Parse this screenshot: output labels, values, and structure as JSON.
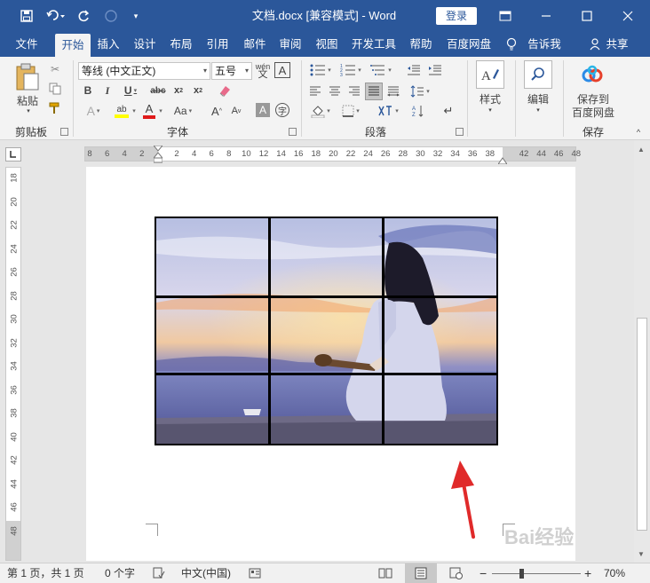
{
  "titlebar": {
    "doc_title": "文档.docx [兼容模式] - Word",
    "login": "登录"
  },
  "tabs": [
    "文件",
    "开始",
    "插入",
    "设计",
    "布局",
    "引用",
    "邮件",
    "审阅",
    "视图",
    "开发工具",
    "帮助",
    "百度网盘"
  ],
  "tell_me": "告诉我",
  "share": "共享",
  "ribbon": {
    "clipboard": {
      "paste": "粘贴",
      "label": "剪贴板"
    },
    "font": {
      "name": "等线 (中文正文)",
      "size": "五号",
      "label": "字体"
    },
    "paragraph": {
      "label": "段落"
    },
    "styles": {
      "button": "样式",
      "label": "样式"
    },
    "editing": {
      "button": "编辑"
    },
    "save": {
      "button_line1": "保存到",
      "button_line2": "百度网盘",
      "label": "保存"
    }
  },
  "ruler": {
    "h_left": [
      "8",
      "6",
      "4",
      "2"
    ],
    "h_main": [
      "2",
      "4",
      "6",
      "8",
      "10",
      "12",
      "14",
      "16",
      "18",
      "20",
      "22",
      "24",
      "26",
      "28",
      "30",
      "32",
      "34",
      "36",
      "38"
    ],
    "h_right": [
      "42",
      "44",
      "46",
      "48"
    ],
    "v": [
      "18",
      "20",
      "22",
      "24",
      "26",
      "28",
      "30",
      "32",
      "34",
      "36",
      "38",
      "40",
      "42",
      "44",
      "46",
      "48"
    ]
  },
  "status": {
    "page": "第 1 页，共 1 页",
    "words": "0 个字",
    "lang": "中文(中国)",
    "zoom": "70%",
    "zoom_level": 0.7
  },
  "watermark": "Bai经验",
  "colors": {
    "accent": "#2b579a",
    "highlight": "#ffff00",
    "font_color": "#e01b1b",
    "annotation_arrow": "#e02a2a"
  }
}
